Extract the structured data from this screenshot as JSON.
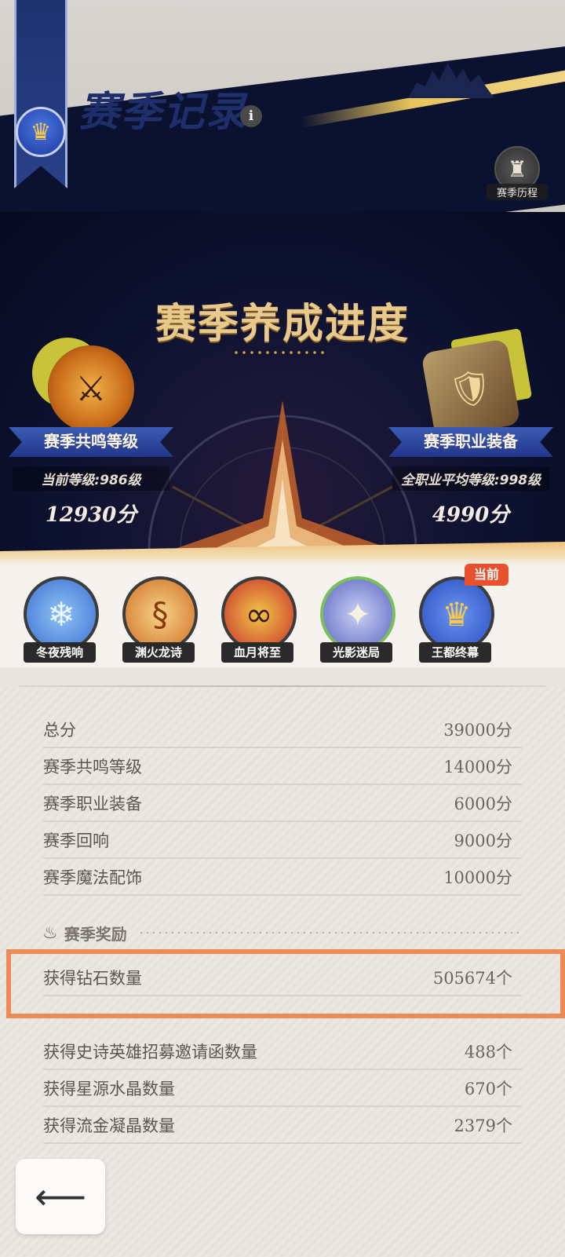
{
  "header": {
    "title": "赛季记录",
    "info_icon": "i",
    "history_label": "赛季历程"
  },
  "progress": {
    "title": "赛季养成进度",
    "resonance": {
      "label": "赛季共鸣等级",
      "level": "当前等级:986级",
      "score": "12930分"
    },
    "equipment": {
      "label": "赛季职业装备",
      "level": "全职业平均等级:998级",
      "score": "4990分"
    }
  },
  "seasons": [
    {
      "label": "冬夜残响",
      "icon": "snowflake-icon",
      "color": "#4a86e0"
    },
    {
      "label": "渊火龙诗",
      "icon": "fire-dragon-icon",
      "color": "#d2782a"
    },
    {
      "label": "血月将至",
      "icon": "blood-moon-icon",
      "color": "#c83a2a"
    },
    {
      "label": "光影迷局",
      "icon": "star-compass-icon",
      "color": "#6a78c8"
    },
    {
      "label": "王都终幕",
      "icon": "crown-icon",
      "color": "#3a64d8"
    }
  ],
  "current_tag": "当前",
  "scores": [
    {
      "label": "总分",
      "value": "39000分"
    },
    {
      "label": "赛季共鸣等级",
      "value": "14000分"
    },
    {
      "label": "赛季职业装备",
      "value": "6000分"
    },
    {
      "label": "赛季回响",
      "value": "9000分"
    },
    {
      "label": "赛季魔法配饰",
      "value": "10000分"
    }
  ],
  "reward_heading": "赛季奖励",
  "rewards": [
    {
      "label": "获得钻石数量",
      "value": "505674个"
    },
    {
      "label": "获得史诗英雄招募邀请函数量",
      "value": "488个"
    },
    {
      "label": "获得星源水晶数量",
      "value": "670个"
    },
    {
      "label": "获得流金凝晶数量",
      "value": "2379个"
    }
  ],
  "colors": {
    "navy": "#0b1230",
    "accent_orange": "#ee8a55",
    "gold": "#e9c98b",
    "current_tag": "#e8502e"
  }
}
